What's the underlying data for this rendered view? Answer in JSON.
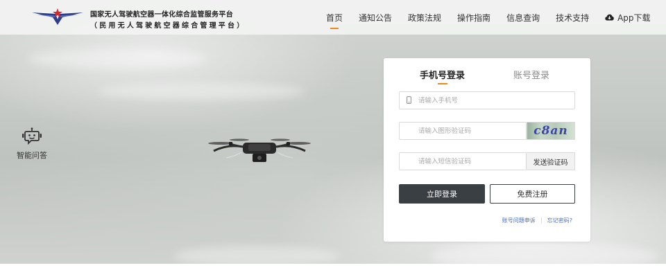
{
  "header": {
    "title_cn": "国家无人驾驶航空器一体化综合监管服务平台",
    "subtitle_cn": "（民用无人驾驶航空器综合管理平台）",
    "nav": [
      "首页",
      "通知公告",
      "政策法规",
      "操作指南",
      "信息查询",
      "技术支持"
    ],
    "app_download": "App下载",
    "active_nav": "首页"
  },
  "helper": {
    "label": "智能问答",
    "icon": "robot-icon"
  },
  "login": {
    "tabs": [
      "手机号登录",
      "账号登录"
    ],
    "active_tab": "手机号登录",
    "phone_placeholder": "请输入手机号",
    "captcha_placeholder": "请输入图形验证码",
    "captcha_text": "c8an",
    "sms_placeholder": "请输入短信验证码",
    "send_code": "发送验证码",
    "login_button": "立即登录",
    "register_button": "免费注册",
    "account_issue": "账号问题申诉",
    "forgot_password": "忘记密码?"
  },
  "colors": {
    "accent": "#e88a1a",
    "primary_button": "#3a3f44",
    "link": "#4a6fb5",
    "captcha_text": "#3c46a8"
  }
}
